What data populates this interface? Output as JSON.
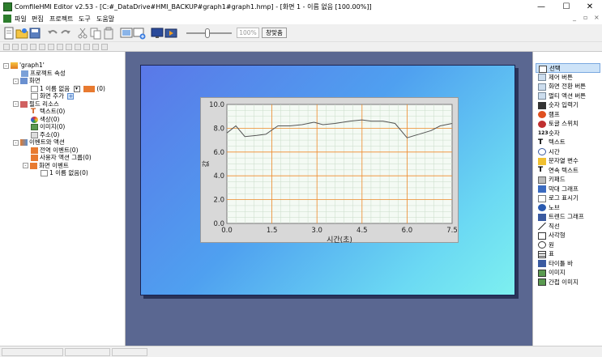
{
  "window": {
    "title": "ComfileHMI Editor v2.53 - [C:#_DataDrive#HMI_BACKUP#graph1#graph1.hmp] - [화면 1 - 이름 없음 [100.00%]]",
    "minimize": "—",
    "maximize": "☐",
    "close": "✕"
  },
  "menu": {
    "items": [
      "파일",
      "편집",
      "프로젝트",
      "도구",
      "도움말"
    ],
    "mdi_buttons": [
      "_",
      "▫",
      "×"
    ]
  },
  "toolbar": {
    "zoom_value": "100%",
    "fit_button": "창맞춤"
  },
  "tree": {
    "rows": [
      {
        "exp": "-",
        "label": "'graph1'"
      },
      {
        "exp": "",
        "label": "프로젝트 속성"
      },
      {
        "exp": "-",
        "label": "화면"
      },
      {
        "exp": "",
        "label": "1 이름 없음",
        "count": "(0)"
      },
      {
        "exp": "",
        "label": "화면 추가",
        "add": "+"
      },
      {
        "exp": "-",
        "label": "필드 리소스"
      },
      {
        "exp": "",
        "label": "텍스트(0)"
      },
      {
        "exp": "",
        "label": "색상(0)"
      },
      {
        "exp": "",
        "label": "이미지(0)"
      },
      {
        "exp": "",
        "label": "주소(0)"
      },
      {
        "exp": "-",
        "label": "이벤트와 액션"
      },
      {
        "exp": "",
        "label": "전역 이벤트(0)"
      },
      {
        "exp": "",
        "label": "사용자 액션 그룹(0)"
      },
      {
        "exp": "-",
        "label": "화면 이벤트"
      },
      {
        "exp": "",
        "label": "1 이름 없음(0)"
      }
    ]
  },
  "palette": {
    "items": [
      "선택",
      "제어 버튼",
      "화면 전환 버튼",
      "멀티 액션 버튼",
      "숫자 입력기",
      "램프",
      "토글 스위치",
      "숫자",
      "텍스트",
      "시간",
      "문자열 변수",
      "연속 텍스트",
      "키패드",
      "막대 그래프",
      "로그 표시기",
      "노브",
      "트렌드 그래프",
      "직선",
      "사각형",
      "원",
      "표",
      "타이틀 바",
      "이미지",
      "간접 이미지"
    ]
  },
  "chart_data": {
    "type": "line",
    "xlabel": "시간(초)",
    "ylabel": "값",
    "xlim": [
      0,
      7.5
    ],
    "ylim": [
      0,
      10
    ],
    "x_ticks": [
      "0.0",
      "1.5",
      "3.0",
      "4.5",
      "6.0",
      "7.5"
    ],
    "y_ticks": [
      "0.0",
      "2.0",
      "4.0",
      "6.0",
      "8.0",
      "10.0"
    ],
    "grid": true,
    "x": [
      0,
      0.3,
      0.6,
      1.0,
      1.3,
      1.7,
      2.1,
      2.5,
      2.9,
      3.2,
      3.6,
      4.1,
      4.5,
      4.8,
      5.2,
      5.6,
      6.0,
      6.4,
      6.8,
      7.1,
      7.5
    ],
    "y": [
      7.6,
      8.2,
      7.3,
      7.4,
      7.5,
      8.2,
      8.2,
      8.3,
      8.5,
      8.3,
      8.4,
      8.6,
      8.7,
      8.6,
      8.6,
      8.4,
      7.2,
      7.5,
      7.8,
      8.2,
      8.4
    ],
    "line_color": "#555555",
    "major_grid_color": "#f08a2a",
    "minor_grid_color": "#c9dcc9",
    "plot_bg": "#f4faf4"
  }
}
